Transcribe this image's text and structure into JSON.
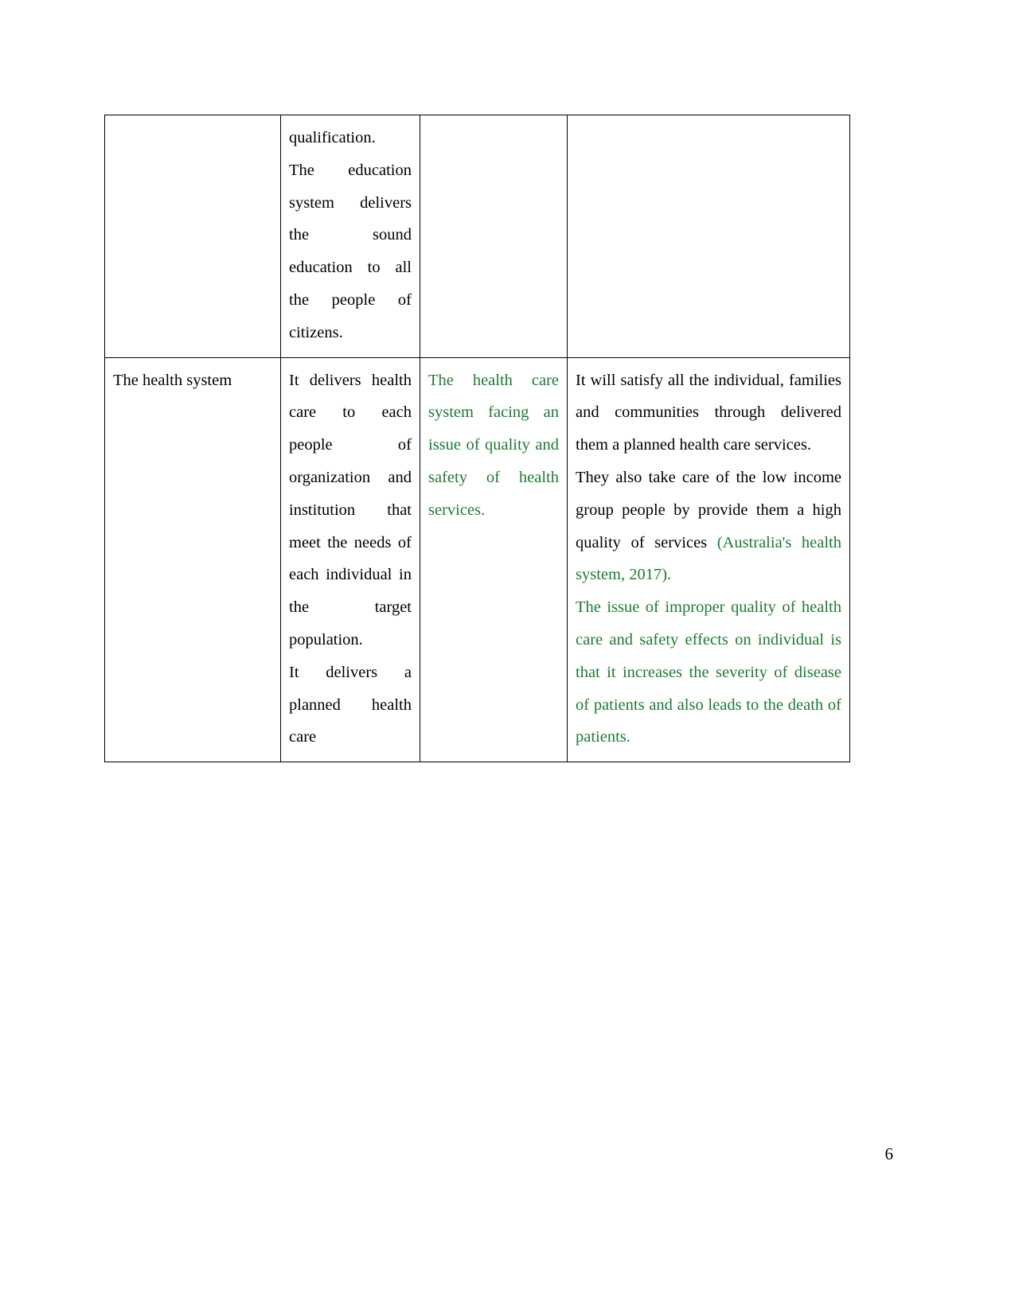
{
  "document": {
    "page_number": "6",
    "accent_green": "#1e7b30",
    "text_black": "#000000"
  },
  "table": {
    "rows": [
      {
        "name": "row-education-continued",
        "cells": [
          {
            "name": "cell-topic",
            "color": "black",
            "paragraphs": []
          },
          {
            "name": "cell-description",
            "color": "black",
            "paragraphs": [
              "qualification.",
              "The education system delivers the sound education to all the people of citizens."
            ]
          },
          {
            "name": "cell-issue",
            "color": "black",
            "paragraphs": []
          },
          {
            "name": "cell-outcome",
            "color": "black",
            "paragraphs": []
          }
        ]
      },
      {
        "name": "row-health-system",
        "cells": [
          {
            "name": "cell-topic",
            "color": "black",
            "paragraphs": [
              "The health system"
            ]
          },
          {
            "name": "cell-description",
            "color": "black",
            "paragraphs": [
              "It delivers health care to each people of organization and institution that meet the needs of each individual in the target population.",
              "It delivers a planned health care"
            ]
          },
          {
            "name": "cell-issue",
            "color": "green",
            "paragraphs": [
              "The health care system facing an issue of quality and safety of health services."
            ]
          },
          {
            "name": "cell-outcome",
            "color": "mixed",
            "paragraphs": [
              {
                "runs": [
                  {
                    "text": "It will satisfy all the individual, families and communities through delivered them a planned health care services.",
                    "color": "black"
                  }
                ]
              },
              {
                "runs": [
                  {
                    "text": "They also take care of the low income group people by provide them a high quality of services ",
                    "color": "black"
                  },
                  {
                    "text": "(Australia's health system, 2017).",
                    "color": "green"
                  }
                ]
              },
              {
                "runs": [
                  {
                    "text": "The issue of improper quality of health care and safety effects on individual is that it increases the severity of disease of patients and also leads to the death of patients.",
                    "color": "green"
                  }
                ]
              }
            ]
          }
        ]
      }
    ]
  }
}
